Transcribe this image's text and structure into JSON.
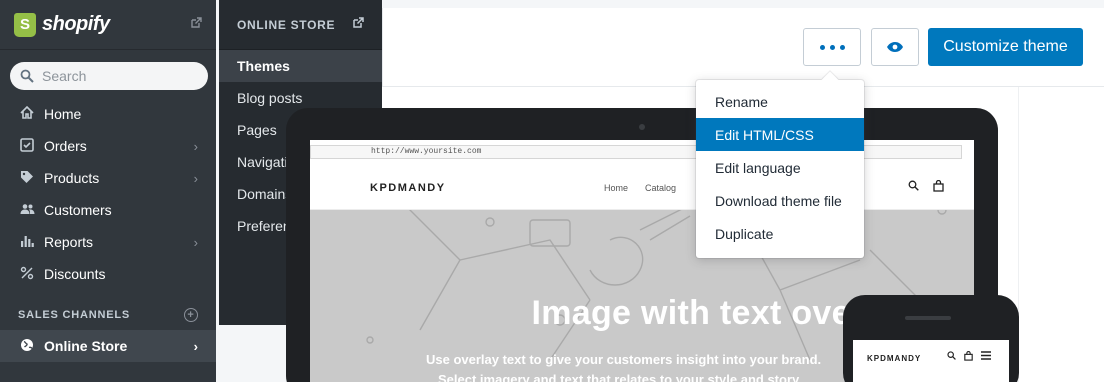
{
  "brand": {
    "name": "shopify",
    "logo_letter": "S",
    "external_icon": "external-link-icon"
  },
  "search": {
    "placeholder": "Search"
  },
  "nav": [
    {
      "label": "Home",
      "icon": "home-icon",
      "chevron": false
    },
    {
      "label": "Orders",
      "icon": "orders-icon",
      "chevron": true
    },
    {
      "label": "Products",
      "icon": "tag-icon",
      "chevron": true
    },
    {
      "label": "Customers",
      "icon": "customers-icon",
      "chevron": false
    },
    {
      "label": "Reports",
      "icon": "bar-chart-icon",
      "chevron": true
    },
    {
      "label": "Discounts",
      "icon": "discount-icon",
      "chevron": false
    }
  ],
  "sales_channels": {
    "heading": "SALES CHANNELS",
    "add_icon": "plus-circle-icon"
  },
  "online_store_nav": {
    "label": "Online Store",
    "icon": "globe-icon"
  },
  "subnav": {
    "heading": "ONLINE STORE",
    "items": [
      "Themes",
      "Blog posts",
      "Pages",
      "Navigation",
      "Domains",
      "Preferences"
    ],
    "active_index": 0
  },
  "toolbar": {
    "more_icon": "more-dots-icon",
    "preview_icon": "eye-icon",
    "customize_label": "Customize theme"
  },
  "dropdown": {
    "items": [
      "Rename",
      "Edit HTML/CSS",
      "Edit language",
      "Download theme file",
      "Duplicate"
    ],
    "highlighted_index": 1
  },
  "preview": {
    "url": "http://www.yoursite.com",
    "logo": "KPDMANDY",
    "links": [
      "Home",
      "Catalog"
    ],
    "hero_title": "Image with text overlay",
    "hero_line1": "Use overlay text to give your customers insight into your brand.",
    "hero_line2": "Select imagery and text that relates to your style and story."
  },
  "colors": {
    "accent": "#0078bd",
    "sidebar": "#31373d",
    "subbar": "#262b30",
    "brand_green": "#95bf47"
  }
}
